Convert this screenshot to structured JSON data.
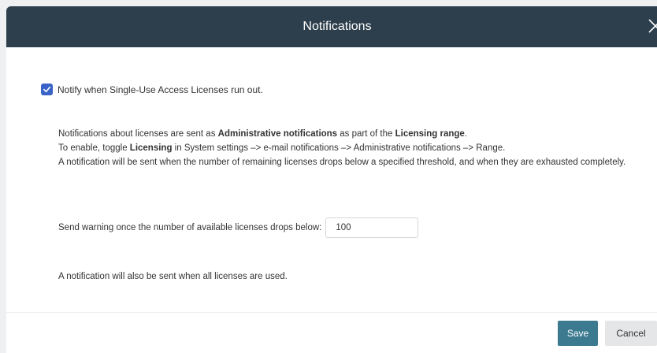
{
  "dialog": {
    "title": "Notifications",
    "close_icon": "close-icon"
  },
  "checkbox": {
    "checked": true,
    "label": "Notify when Single-Use Access Licenses run out.",
    "check_icon": "checkmark-icon"
  },
  "info": {
    "line1_pre": "Notifications about licenses are sent as ",
    "line1_bold1": "Administrative notifications",
    "line1_mid": " as part of the ",
    "line1_bold2": "Licensing range",
    "line1_post": ".",
    "line2_pre": "To enable, toggle ",
    "line2_bold": "Licensing",
    "line2_post": " in System settings –> e-mail notifications –> Administrative notifications –> Range.",
    "line3": "A notification will be sent when the number of remaining licenses drops below a specified threshold, and when they are exhausted completely."
  },
  "threshold": {
    "label": "Send warning once the number of available licenses drops below:",
    "value": "100"
  },
  "final_note": "A notification will also be sent when all licenses are used.",
  "footer": {
    "save_label": "Save",
    "cancel_label": "Cancel"
  },
  "colors": {
    "titlebar": "#2d3f4c",
    "checkbox": "#3a63c8",
    "save_button": "#3b7a8f",
    "cancel_button": "#e4e6e8"
  }
}
